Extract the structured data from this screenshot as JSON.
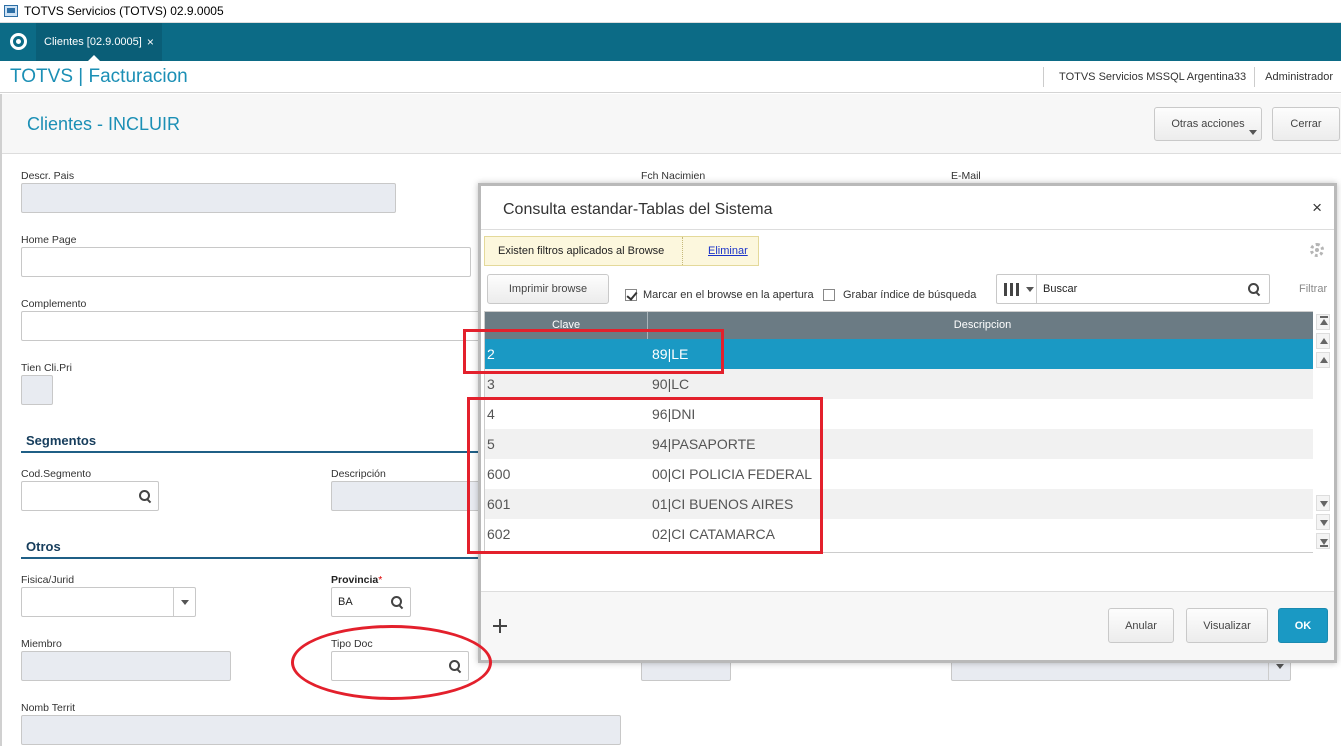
{
  "window": {
    "title": "TOTVS Servicios (TOTVS) 02.9.0005"
  },
  "tabs": [
    {
      "label": "Clientes [02.9.0005]",
      "close": "×"
    }
  ],
  "module": {
    "title": "TOTVS | Facturacion",
    "environment": "TOTVS Servicios MSSQL Argentina33",
    "user": "Administrador"
  },
  "page": {
    "title": "Clientes - INCLUIR",
    "actions": {
      "otras": "Otras acciones",
      "cerrar": "Cerrar"
    }
  },
  "form": {
    "descr_pais": {
      "label": "Descr. Pais",
      "value": ""
    },
    "fch_nacimien": {
      "label": "Fch Nacimien"
    },
    "email": {
      "label": "E-Mail"
    },
    "home_page": {
      "label": "Home Page",
      "value": ""
    },
    "complemento": {
      "label": "Complemento",
      "value": ""
    },
    "tien_cli_pri": {
      "label": "Tien Cli.Pri"
    },
    "section_segmentos": "Segmentos",
    "cod_segmento": {
      "label": "Cod.Segmento",
      "value": ""
    },
    "descripcion": {
      "label": "Descripción",
      "value": ""
    },
    "section_otros": "Otros",
    "fisica_jurid": {
      "label": "Fisica/Jurid",
      "value": ""
    },
    "provincia": {
      "label": "Provincia",
      "required_mark": "*",
      "value": "BA"
    },
    "miembro": {
      "label": "Miembro",
      "value": ""
    },
    "tipo_doc": {
      "label": "Tipo Doc",
      "value": ""
    },
    "nomb_territ": {
      "label": "Nomb Territ",
      "value": ""
    }
  },
  "dialog": {
    "title": "Consulta estandar-Tablas del Sistema",
    "close": "×",
    "filter_notice": "Existen filtros aplicados al Browse",
    "filter_link": "Eliminar",
    "print_button": "Imprimir browse",
    "check_mark": {
      "label": "Marcar en el browse en la apertura",
      "checked": true
    },
    "check_save": {
      "label": "Grabar índice de búsqueda",
      "checked": false
    },
    "search_placeholder": "Buscar",
    "filter_button": "Filtrar",
    "columns": [
      "Clave",
      "Descripcion"
    ],
    "rows": [
      {
        "clave": "2",
        "descripcion": "89|LE",
        "selected": true
      },
      {
        "clave": "3",
        "descripcion": "90|LC"
      },
      {
        "clave": "4",
        "descripcion": "96|DNI"
      },
      {
        "clave": "5",
        "descripcion": "94|PASAPORTE"
      },
      {
        "clave": "600",
        "descripcion": "00|CI POLICIA FEDERAL"
      },
      {
        "clave": "601",
        "descripcion": "01|CI BUENOS AIRES"
      },
      {
        "clave": "602",
        "descripcion": "02|CI CATAMARCA"
      }
    ],
    "buttons": {
      "anular": "Anular",
      "visualizar": "Visualizar",
      "ok": "OK"
    }
  },
  "colors": {
    "accent": "#1a99c4",
    "tabbar": "#0c6b86",
    "annotation": "#e3202c"
  }
}
